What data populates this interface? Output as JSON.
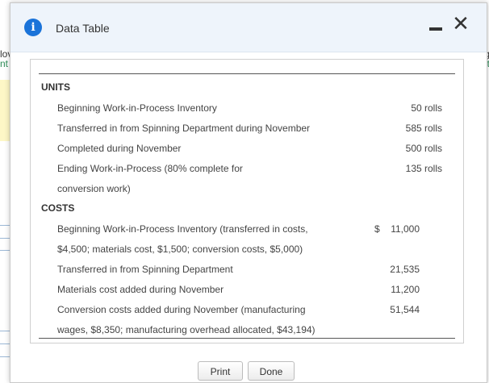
{
  "background": {
    "left_line1": "lov",
    "left_line2": "nt",
    "right_line1": "g",
    "right_line2": "ct"
  },
  "dialog": {
    "title": "Data Table",
    "info_glyph": "i",
    "close_glyph": "✕",
    "icons": [
      "info-icon",
      "minimize-icon",
      "close-icon"
    ]
  },
  "table": {
    "units_header": "UNITS",
    "units_rows": [
      {
        "label": "Beginning Work-in-Process Inventory",
        "value": "50 rolls"
      },
      {
        "label": "Transferred in from Spinning Department during November",
        "value": "585 rolls"
      },
      {
        "label": "Completed during November",
        "value": "500 rolls"
      },
      {
        "label": "Ending Work-in-Process (80% complete for",
        "value": "135 rolls"
      },
      {
        "label": "conversion work)",
        "value": ""
      }
    ],
    "costs_header": "COSTS",
    "costs_rows": [
      {
        "label": "Beginning Work-in-Process Inventory (transferred in costs,",
        "value": "11,000",
        "currency": "$"
      },
      {
        "label": "$4,500; materials cost, $1,500; conversion costs, $5,000)",
        "value": ""
      },
      {
        "label": "Transferred in from Spinning Department",
        "value": "21,535"
      },
      {
        "label": "Materials cost added during November",
        "value": "11,200"
      },
      {
        "label": "Conversion costs added during November (manufacturing",
        "value": "51,544"
      },
      {
        "label": "wages, $8,350; manufacturing overhead allocated, $43,194)",
        "value": ""
      }
    ]
  },
  "buttons": {
    "print_label": "Print",
    "done_label": "Done"
  }
}
